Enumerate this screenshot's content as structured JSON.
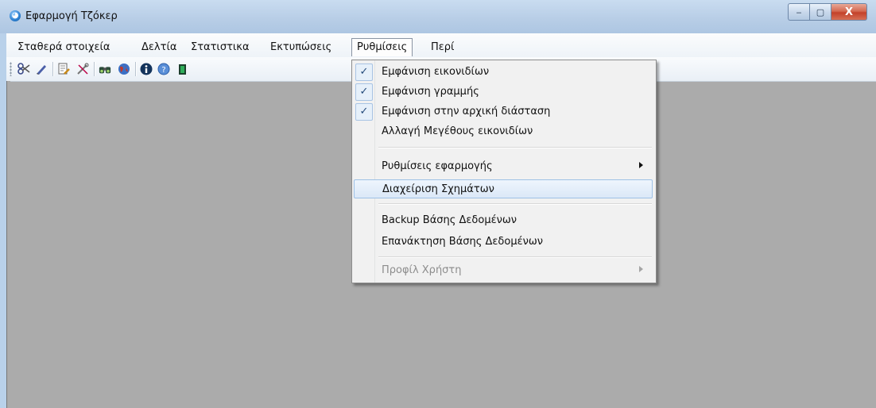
{
  "window": {
    "title": "Εφαρμογή Τζόκερ",
    "minimize": "‒",
    "maximize": "▢",
    "close": "X"
  },
  "menubar": [
    {
      "label": "Σταθερά στοιχεία"
    },
    {
      "label": "Δελτία"
    },
    {
      "label": "Στατιστικα"
    },
    {
      "label": "Εκτυπώσεις"
    },
    {
      "label": "Ρυθμίσεις"
    },
    {
      "label": "Περί"
    }
  ],
  "toolbar": [
    {
      "icon": "scissors-icon"
    },
    {
      "icon": "pen-icon"
    },
    {
      "icon": "edit-document-icon"
    },
    {
      "icon": "tools-icon"
    },
    {
      "icon": "binoculars-icon"
    },
    {
      "icon": "globe-icon"
    },
    {
      "icon": "info-icon"
    },
    {
      "icon": "help-icon"
    },
    {
      "icon": "exit-door-icon"
    }
  ],
  "dropdown": {
    "items": [
      {
        "label": "Εμφάνιση εικονιδίων",
        "checked": true
      },
      {
        "label": "Εμφάνιση γραμμής",
        "checked": true
      },
      {
        "label": "Εμφάνιση στην αρχική διάσταση",
        "checked": true
      },
      {
        "label": "Αλλαγή Μεγέθους εικονιδίων",
        "checked": false
      },
      {
        "label": "Ρυθμίσεις εφαρμογής",
        "submenu": true
      },
      {
        "label": "Διαχείριση Σχημάτων",
        "highlighted": true
      },
      {
        "label": "Backup Βάσης Δεδομένων"
      },
      {
        "label": "Επανάκτηση Βάσης Δεδομένων"
      },
      {
        "label": "Προφίλ Χρήστη",
        "submenu": true,
        "disabled": true
      }
    ],
    "checkmark": "✓"
  },
  "colors": {
    "client_bg": "#ababab",
    "highlight": "#dbe8f7",
    "disabled_text": "#8d8d8d"
  }
}
